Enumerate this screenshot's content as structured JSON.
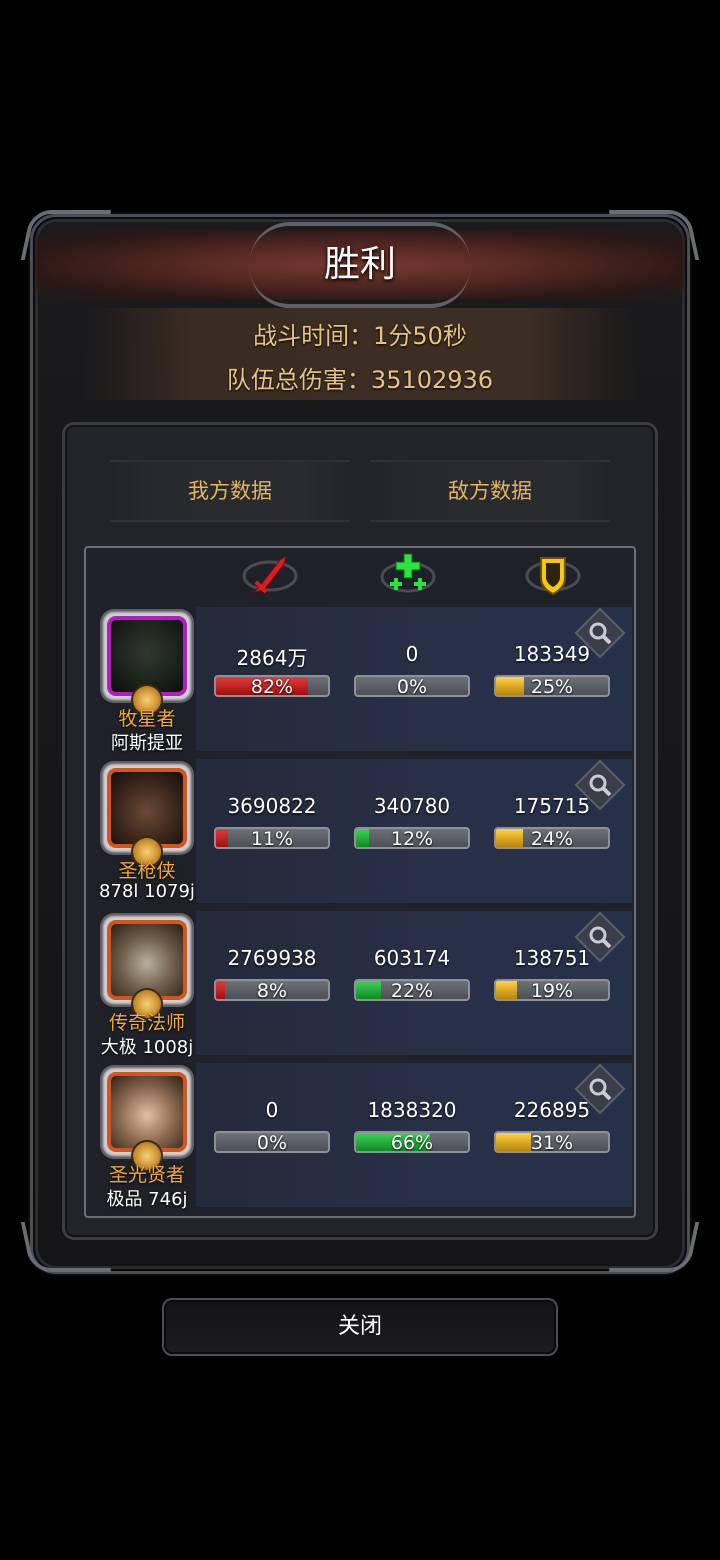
{
  "header": {
    "title": "胜利",
    "battle_time": "战斗时间：1分50秒",
    "team_damage": "队伍总伤害：35102936"
  },
  "tabs": [
    "我方数据",
    "敌方数据"
  ],
  "columns": {
    "icons": [
      "sword-icon",
      "heal-plus-icon",
      "shield-icon"
    ]
  },
  "heroes": [
    {
      "class": "牧星者",
      "name": "阿斯提亚",
      "frame_color": "#b11ec0",
      "damage": "2864万",
      "damage_pct": 82,
      "damage_pct_label": "82%",
      "heal": "0",
      "heal_pct": 0,
      "heal_pct_label": "0%",
      "defense": "183349",
      "defense_pct": 25,
      "defense_pct_label": "25%"
    },
    {
      "class": "圣枪侠",
      "name": "878l 1079j",
      "frame_color": "#d2561c",
      "damage": "3690822",
      "damage_pct": 11,
      "damage_pct_label": "11%",
      "heal": "340780",
      "heal_pct": 12,
      "heal_pct_label": "12%",
      "defense": "175715",
      "defense_pct": 24,
      "defense_pct_label": "24%"
    },
    {
      "class": "传奇法师",
      "name": "大极 1008j",
      "frame_color": "#d2561c",
      "damage": "2769938",
      "damage_pct": 8,
      "damage_pct_label": "8%",
      "heal": "603174",
      "heal_pct": 22,
      "heal_pct_label": "22%",
      "defense": "138751",
      "defense_pct": 19,
      "defense_pct_label": "19%"
    },
    {
      "class": "圣光贤者",
      "name": "极品 746j",
      "frame_color": "#d2561c",
      "damage": "0",
      "damage_pct": 0,
      "damage_pct_label": "0%",
      "heal": "1838320",
      "heal_pct": 66,
      "heal_pct_label": "66%",
      "defense": "226895",
      "defense_pct": 31,
      "defense_pct_label": "31%"
    }
  ],
  "close_label": "关闭"
}
